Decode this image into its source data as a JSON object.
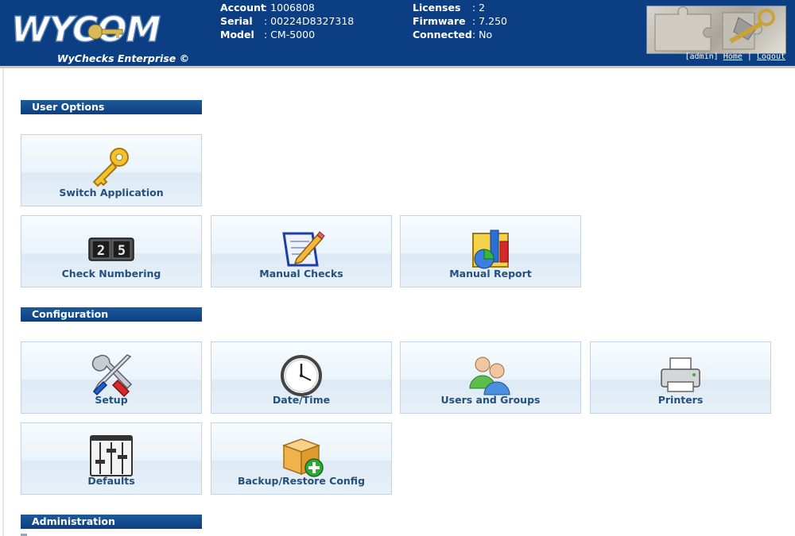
{
  "header": {
    "logo_text": "WYCOM",
    "tagline": "WyChecks Enterprise ©",
    "info": [
      {
        "label": "Account",
        "value": ": 1006808"
      },
      {
        "label": "Serial",
        "value": ": 00224D8327318"
      },
      {
        "label": "Model",
        "value": ": CM-5000"
      },
      {
        "label": "Licenses",
        "value": ": 2"
      },
      {
        "label": "Firmware",
        "value": ": 7.250"
      },
      {
        "label": "Connected",
        "value": ": No"
      }
    ],
    "user": "[admin]",
    "home_link": "Home",
    "separator": "|",
    "logout_link": "Logout",
    "brand_color": "#0b3e82"
  },
  "sections": {
    "user_options": "User Options",
    "configuration": "Configuration",
    "administration": "Administration"
  },
  "tiles": {
    "switch_application": {
      "label": "Switch Application",
      "icon": "key-icon"
    },
    "check_numbering": {
      "label": "Check Numbering",
      "icon": "counter-icon",
      "counter_digits": [
        "2",
        "5"
      ]
    },
    "manual_checks": {
      "label": "Manual Checks",
      "icon": "notepad-pencil-icon"
    },
    "manual_report": {
      "label": "Manual Report",
      "icon": "report-chart-icon"
    },
    "setup": {
      "label": "Setup",
      "icon": "tools-icon"
    },
    "date_time": {
      "label": "Date/Time",
      "icon": "clock-icon"
    },
    "users_groups": {
      "label": "Users and Groups",
      "icon": "users-icon"
    },
    "printers": {
      "label": "Printers",
      "icon": "printer-icon"
    },
    "defaults": {
      "label": "Defaults",
      "icon": "sliders-icon"
    },
    "backup_restore": {
      "label": "Backup/Restore Config",
      "icon": "box-add-icon"
    }
  }
}
